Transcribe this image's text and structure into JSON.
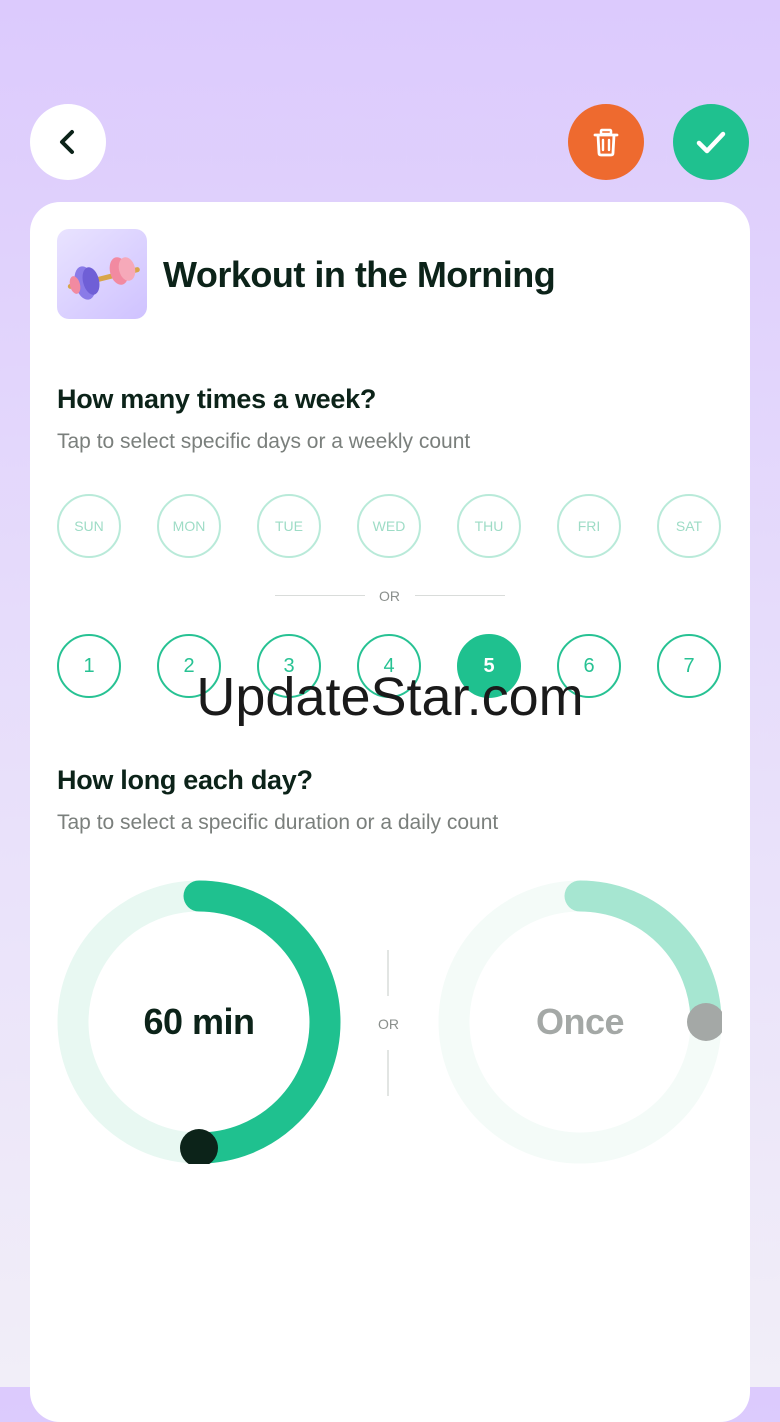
{
  "header": {
    "back_icon": "chevron-left-icon",
    "delete_icon": "trash-icon",
    "confirm_icon": "check-icon",
    "delete_color": "#ee6a2f",
    "confirm_color": "#1fc18f"
  },
  "habit": {
    "title": "Workout in the Morning",
    "icon": "dumbbell-icon"
  },
  "frequency": {
    "title": "How many times a week?",
    "subtitle": "Tap to select specific days or a weekly count",
    "days": [
      "SUN",
      "MON",
      "TUE",
      "WED",
      "THU",
      "FRI",
      "SAT"
    ],
    "or_label": "OR",
    "counts": [
      "1",
      "2",
      "3",
      "4",
      "5",
      "6",
      "7"
    ],
    "selected_count": "5"
  },
  "duration": {
    "title": "How long each day?",
    "subtitle": "Tap to select a specific duration or a daily count",
    "duration_label": "60 min",
    "duration_fraction": 0.5,
    "or_label": "OR",
    "count_label": "Once",
    "count_fraction": 0.25
  },
  "colors": {
    "accent": "#1fc18f",
    "accent_light": "#a6e6d1",
    "track": "#e8f8f2",
    "knob_dark": "#0c2319",
    "knob_gray": "#a4a8a6"
  },
  "watermark": "UpdateStar.com"
}
